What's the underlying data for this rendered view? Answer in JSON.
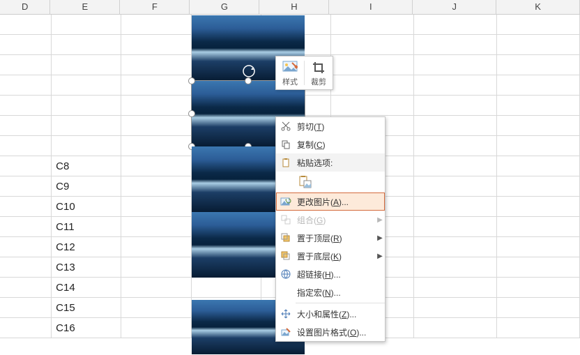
{
  "columns": [
    "D",
    "E",
    "F",
    "G",
    "H",
    "I",
    "J",
    "K"
  ],
  "rows": {
    "c_labels": [
      "",
      "",
      "",
      "",
      "",
      "",
      "",
      "C8",
      "C9",
      "C10",
      "C11",
      "C12",
      "C13",
      "C14",
      "C15",
      "C16"
    ]
  },
  "mini_toolbar": {
    "style_label": "样式",
    "crop_label": "裁剪"
  },
  "menu": {
    "cut": "剪切(T)",
    "copy": "复制(C)",
    "paste_header": "粘贴选项:",
    "change_picture": "更改图片(A)...",
    "group": "组合(G)",
    "bring_front": "置于顶层(R)",
    "send_back": "置于底层(K)",
    "hyperlink": "超链接(H)...",
    "assign_macro": "指定宏(N)...",
    "size_props": "大小和属性(Z)...",
    "format_picture": "设置图片格式(O)..."
  },
  "icons": {
    "rotate": "rotate-icon",
    "style": "picture-style-icon",
    "crop": "crop-icon",
    "cut": "scissors-icon",
    "copy": "copy-icon",
    "paste": "clipboard-icon",
    "paste_opt": "paste-option-icon",
    "change": "change-picture-icon",
    "group": "group-icon",
    "front": "bring-front-icon",
    "back": "send-back-icon",
    "link": "link-icon",
    "size": "size-arrows-icon",
    "format": "format-picture-icon"
  }
}
